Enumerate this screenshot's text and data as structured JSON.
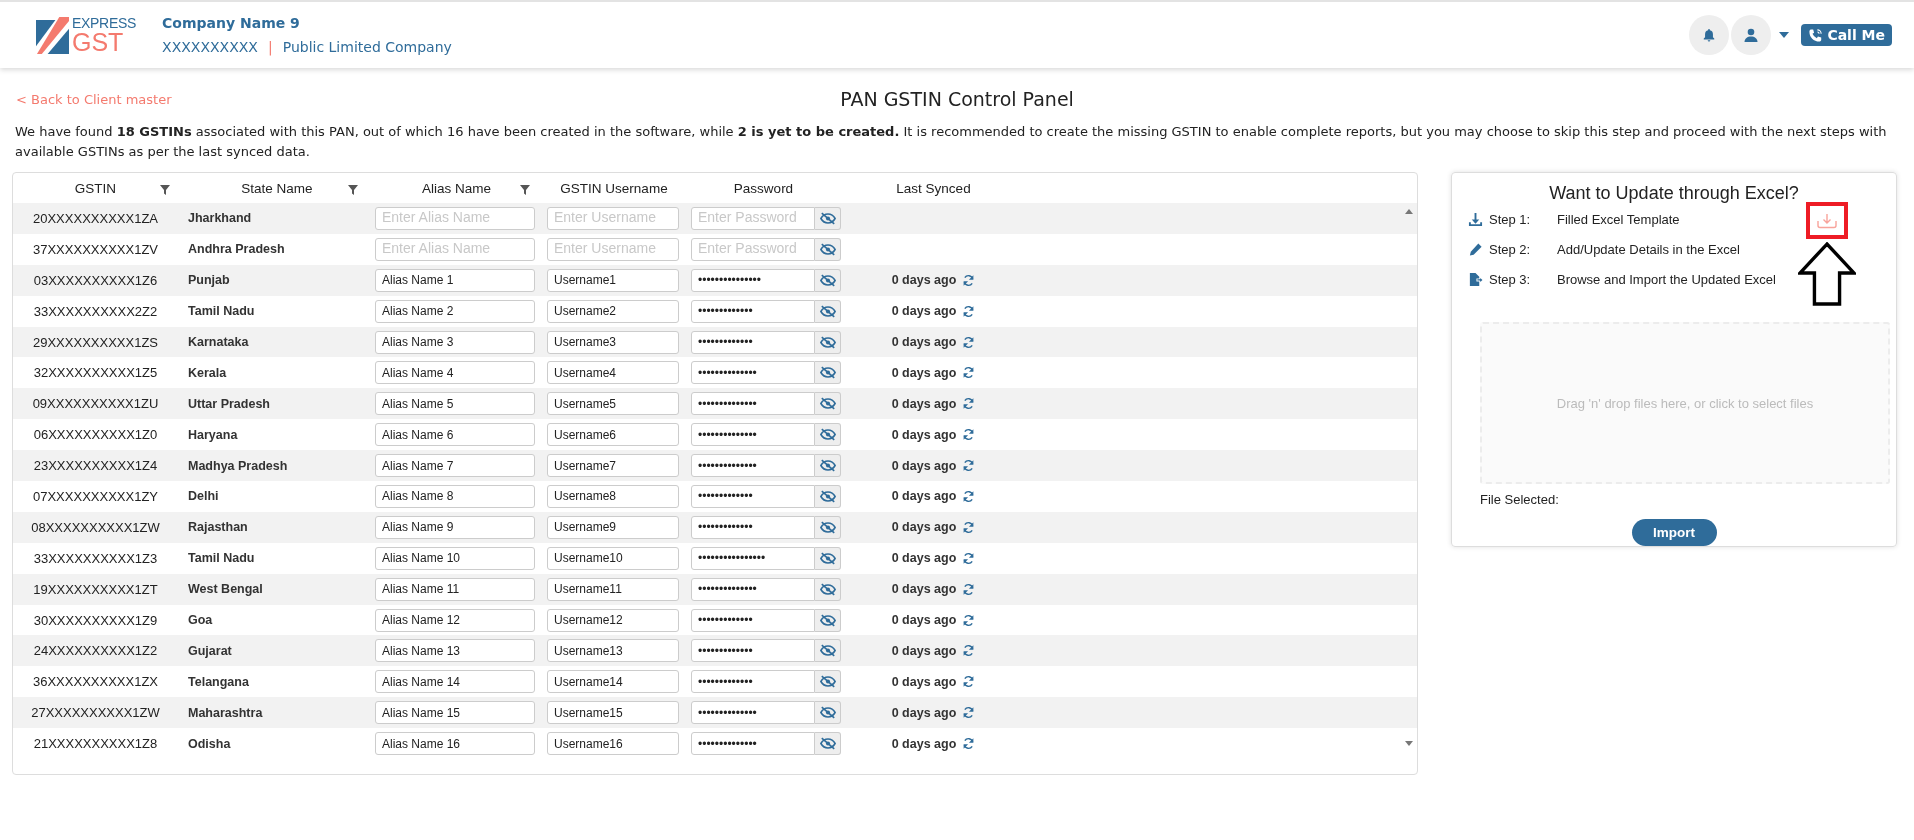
{
  "header": {
    "logo_top": "EXPRESS",
    "logo_bottom": "GST",
    "company_name": "Company Name 9",
    "pan": "XXXXXXXXXX",
    "separator": "|",
    "company_type": "Public Limited Company",
    "call_button": "Call Me"
  },
  "back_link": "< Back to Client master",
  "page_title": "PAN GSTIN Control Panel",
  "description": "We have found **18 GSTINs** associated with this PAN, out of which 16 have been created in the software, while **2 is yet to be created.** It is recommended to create the missing GSTIN to enable complete reports, but you may choose to skip this step and proceed with the next steps with available GSTINs as per the last synced data.",
  "table": {
    "columns": [
      {
        "label": "GSTIN",
        "filter": true
      },
      {
        "label": "State Name",
        "filter": true
      },
      {
        "label": "Alias Name",
        "filter": true
      },
      {
        "label": "GSTIN Username",
        "filter": false
      },
      {
        "label": "Password",
        "filter": false
      },
      {
        "label": "Last Synced",
        "filter": false
      }
    ],
    "rows": [
      {
        "gstin": "20XXXXXXXXXX1ZA",
        "state": "Jharkhand",
        "alias": {
          "placeholder": "Enter Alias Name"
        },
        "username": {
          "placeholder": "Enter Username"
        },
        "password": {
          "placeholder": "Enter Password"
        }
      },
      {
        "gstin": "37XXXXXXXXXX1ZV",
        "state": "Andhra Pradesh",
        "alias": {
          "placeholder": "Enter Alias Name"
        },
        "username": {
          "placeholder": "Enter Username"
        },
        "password": {
          "placeholder": "Enter Password"
        }
      },
      {
        "gstin": "03XXXXXXXXXX1Z6",
        "state": "Punjab",
        "alias": {
          "value": "Alias Name 1"
        },
        "username": {
          "value": "Username1"
        },
        "password": {
          "value": "•••••••••••••••"
        },
        "last_synced": "0 days ago"
      },
      {
        "gstin": "33XXXXXXXXXX2Z2",
        "state": "Tamil Nadu",
        "alias": {
          "value": "Alias Name 2"
        },
        "username": {
          "value": "Username2"
        },
        "password": {
          "value": "•••••••••••••"
        },
        "last_synced": "0 days ago"
      },
      {
        "gstin": "29XXXXXXXXXX1ZS",
        "state": "Karnataka",
        "alias": {
          "value": "Alias Name 3"
        },
        "username": {
          "value": "Username3"
        },
        "password": {
          "value": "•••••••••••••"
        },
        "last_synced": "0 days ago"
      },
      {
        "gstin": "32XXXXXXXXXX1Z5",
        "state": "Kerala",
        "alias": {
          "value": "Alias Name 4"
        },
        "username": {
          "value": "Username4"
        },
        "password": {
          "value": "••••••••••••••"
        },
        "last_synced": "0 days ago"
      },
      {
        "gstin": "09XXXXXXXXXX1ZU",
        "state": "Uttar Pradesh",
        "alias": {
          "value": "Alias Name 5"
        },
        "username": {
          "value": "Username5"
        },
        "password": {
          "value": "••••••••••••••"
        },
        "last_synced": "0 days ago"
      },
      {
        "gstin": "06XXXXXXXXXX1Z0",
        "state": "Haryana",
        "alias": {
          "value": "Alias Name 6"
        },
        "username": {
          "value": "Username6"
        },
        "password": {
          "value": "••••••••••••••"
        },
        "last_synced": "0 days ago"
      },
      {
        "gstin": "23XXXXXXXXXX1Z4",
        "state": "Madhya Pradesh",
        "alias": {
          "value": "Alias Name 7"
        },
        "username": {
          "value": "Username7"
        },
        "password": {
          "value": "••••••••••••••"
        },
        "last_synced": "0 days ago"
      },
      {
        "gstin": "07XXXXXXXXXX1ZY",
        "state": "Delhi",
        "alias": {
          "value": "Alias Name 8"
        },
        "username": {
          "value": "Username8"
        },
        "password": {
          "value": "•••••••••••••"
        },
        "last_synced": "0 days ago"
      },
      {
        "gstin": "08XXXXXXXXXX1ZW",
        "state": "Rajasthan",
        "alias": {
          "value": "Alias Name 9"
        },
        "username": {
          "value": "Username9"
        },
        "password": {
          "value": "•••••••••••••"
        },
        "last_synced": "0 days ago"
      },
      {
        "gstin": "33XXXXXXXXXX1Z3",
        "state": "Tamil Nadu",
        "alias": {
          "value": "Alias Name 10"
        },
        "username": {
          "value": "Username10"
        },
        "password": {
          "value": "••••••••••••••••"
        },
        "last_synced": "0 days ago"
      },
      {
        "gstin": "19XXXXXXXXXX1ZT",
        "state": "West Bengal",
        "alias": {
          "value": "Alias Name 11"
        },
        "username": {
          "value": "Username11"
        },
        "password": {
          "value": "••••••••••••••"
        },
        "last_synced": "0 days ago"
      },
      {
        "gstin": "30XXXXXXXXXX1Z9",
        "state": "Goa",
        "alias": {
          "value": "Alias Name 12"
        },
        "username": {
          "value": "Username12"
        },
        "password": {
          "value": "•••••••••••••"
        },
        "last_synced": "0 days ago"
      },
      {
        "gstin": "24XXXXXXXXXX1Z2",
        "state": "Gujarat",
        "alias": {
          "value": "Alias Name 13"
        },
        "username": {
          "value": "Username13"
        },
        "password": {
          "value": "•••••••••••••"
        },
        "last_synced": "0 days ago"
      },
      {
        "gstin": "36XXXXXXXXXX1ZX",
        "state": "Telangana",
        "alias": {
          "value": "Alias Name 14"
        },
        "username": {
          "value": "Username14"
        },
        "password": {
          "value": "•••••••••••••"
        },
        "last_synced": "0 days ago"
      },
      {
        "gstin": "27XXXXXXXXXX1ZW",
        "state": "Maharashtra",
        "alias": {
          "value": "Alias Name 15"
        },
        "username": {
          "value": "Username15"
        },
        "password": {
          "value": "••••••••••••••"
        },
        "last_synced": "0 days ago"
      },
      {
        "gstin": "21XXXXXXXXXX1Z8",
        "state": "Odisha",
        "alias": {
          "value": "Alias Name 16"
        },
        "username": {
          "value": "Username16"
        },
        "password": {
          "value": "••••••••••••••"
        },
        "last_synced": "0 days ago"
      }
    ]
  },
  "excel_panel": {
    "title": "Want to Update through Excel?",
    "download_highlighted": true,
    "steps": [
      {
        "kind": "download",
        "label": "Step 1:",
        "text": "Filled Excel Template"
      },
      {
        "kind": "edit",
        "label": "Step 2:",
        "text": "Add/Update Details in the Excel"
      },
      {
        "kind": "import",
        "label": "Step 3:",
        "text": "Browse and Import the Updated Excel"
      }
    ],
    "dropzone": "Drag 'n' drop files here, or click to select files",
    "file_selected_label": "File Selected:",
    "import_button": "Import"
  }
}
